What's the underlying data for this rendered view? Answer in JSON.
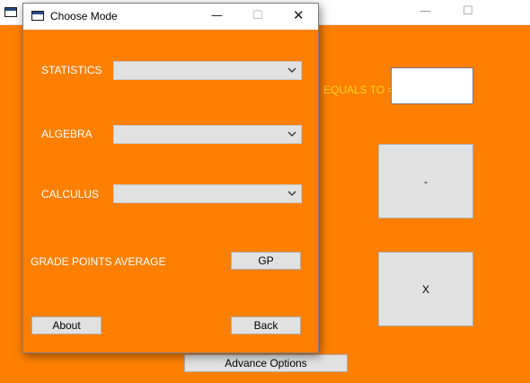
{
  "main_window": {
    "equals_label": "EQUALS TO =",
    "equals_value": "",
    "minus_label": "-",
    "multiply_label": "X",
    "advance_label": "Advance Options",
    "titlebar_icons": [
      "app-icon",
      "minimize-icon",
      "maximize-icon"
    ]
  },
  "dialog": {
    "title": "Choose Mode",
    "fields": {
      "statistics": {
        "label": "STATISTICS",
        "value": ""
      },
      "algebra": {
        "label": "ALGEBRA",
        "value": ""
      },
      "calculus": {
        "label": "CALCULUS",
        "value": ""
      }
    },
    "gpa_label": "GRADE POINTS AVERAGE",
    "gp_button": "GP",
    "about_button": "About",
    "back_button": "Back"
  },
  "colors": {
    "background": "#ff8000",
    "equals_text": "#ffd21f",
    "label_text": "#ffffff",
    "button_face": "#e1e1e1"
  }
}
